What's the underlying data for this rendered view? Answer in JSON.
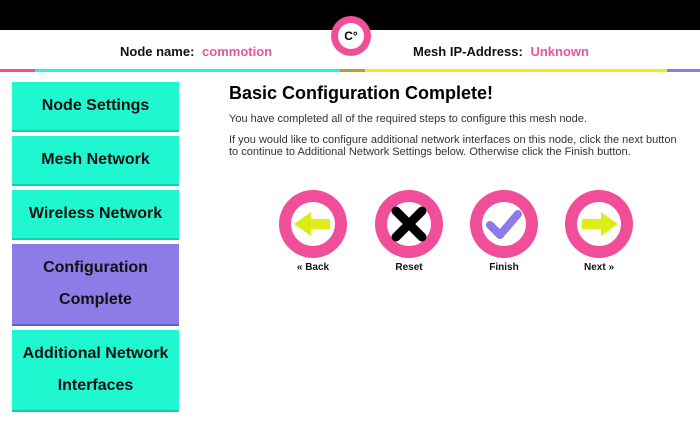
{
  "header": {
    "node_name_label": "Node name:",
    "node_name_value": "commotion",
    "mesh_ip_label": "Mesh IP-Address:",
    "mesh_ip_value": "Unknown",
    "logo_text": "C°"
  },
  "sidebar": {
    "items": [
      {
        "label": "Node Settings",
        "active": false
      },
      {
        "label": "Mesh Network",
        "active": false
      },
      {
        "label": "Wireless Network",
        "active": false
      },
      {
        "label": "Configuration Complete",
        "active": true
      },
      {
        "label": "Additional Network Interfaces",
        "active": false
      }
    ]
  },
  "main": {
    "title": "Basic Configuration Complete!",
    "paragraph1": "You have completed all of the required steps to configure this mesh node.",
    "paragraph2": "If you would like to configure additional network interfaces on this node, click the next button to continue to Additional Network Settings below. Otherwise click the Finish button."
  },
  "buttons": {
    "back": {
      "label": "« Back",
      "icon": "arrow-left-icon"
    },
    "reset": {
      "label": "Reset",
      "icon": "x-icon"
    },
    "finish": {
      "label": "Finish",
      "icon": "checkmark-icon"
    },
    "next": {
      "label": "Next »",
      "icon": "arrow-right-icon"
    }
  },
  "colors": {
    "accent_pink": "#f04e98",
    "nav_teal": "#1ef7cf",
    "nav_active": "#8c7ce8",
    "arrow_yellow": "#dcec14",
    "check_purple": "#8c7ce8",
    "stripe_yellow": "#eaf01e"
  }
}
